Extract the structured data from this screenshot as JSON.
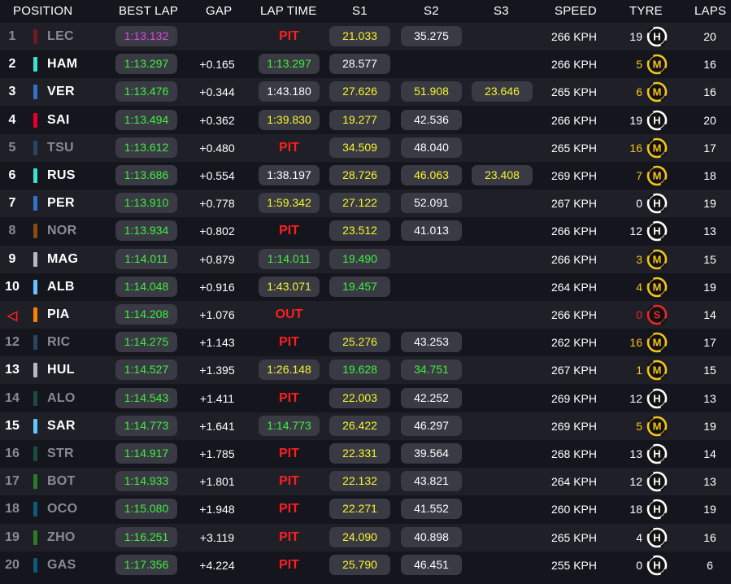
{
  "headers": {
    "position": "POSITION",
    "best_lap": "BEST LAP",
    "gap": "GAP",
    "lap_time": "LAP TIME",
    "s1": "S1",
    "s2": "S2",
    "s3": "S3",
    "speed": "SPEED",
    "tyre": "TYRE",
    "laps": "LAPS"
  },
  "colors": {
    "purple": "#e347e3",
    "green": "#3ef03e",
    "yellow": "#f5f52c",
    "pit_red": "#ff1e1e",
    "medium": "#f5c518",
    "hard": "#ffffff",
    "soft": "#e8292c"
  },
  "rows": [
    {
      "pos": "1",
      "dim": true,
      "code": "LEC",
      "team_color": "#6e1a22",
      "best": "1:13.132",
      "best_purple": true,
      "gap": "",
      "lap": "PIT",
      "lap_style": "pit",
      "s1": "21.033",
      "s1c": "y",
      "s2": "35.275",
      "s2c": "w",
      "s3": "",
      "s3c": "",
      "speed": "266 KPH",
      "age": "19",
      "age_c": "w",
      "tyre": "H",
      "tyre_icon": "hard-tyre-icon",
      "laps": "20"
    },
    {
      "pos": "2",
      "dim": false,
      "code": "HAM",
      "team_color": "#3fe0c8",
      "best": "1:13.297",
      "best_purple": false,
      "gap": "+0.165",
      "lap": "1:13.297",
      "lap_style": "g",
      "s1": "28.577",
      "s1c": "w",
      "s2": "",
      "s2c": "",
      "s3": "",
      "s3c": "",
      "speed": "266 KPH",
      "age": "5",
      "age_c": "y",
      "tyre": "M",
      "tyre_icon": "medium-tyre-icon",
      "laps": "16"
    },
    {
      "pos": "3",
      "dim": false,
      "code": "VER",
      "team_color": "#3671c6",
      "best": "1:13.476",
      "best_purple": false,
      "gap": "+0.344",
      "lap": "1:43.180",
      "lap_style": "w",
      "s1": "27.626",
      "s1c": "y",
      "s2": "51.908",
      "s2c": "y",
      "s3": "23.646",
      "s3c": "y",
      "speed": "265 KPH",
      "age": "6",
      "age_c": "y",
      "tyre": "M",
      "tyre_icon": "medium-tyre-icon",
      "laps": "16"
    },
    {
      "pos": "4",
      "dim": false,
      "code": "SAI",
      "team_color": "#e8002d",
      "best": "1:13.494",
      "best_purple": false,
      "gap": "+0.362",
      "lap": "1:39.830",
      "lap_style": "y",
      "s1": "19.277",
      "s1c": "y",
      "s2": "42.536",
      "s2c": "w",
      "s3": "",
      "s3c": "",
      "speed": "266 KPH",
      "age": "19",
      "age_c": "w",
      "tyre": "H",
      "tyre_icon": "hard-tyre-icon",
      "laps": "20"
    },
    {
      "pos": "5",
      "dim": true,
      "code": "TSU",
      "team_color": "#2b4562",
      "best": "1:13.612",
      "best_purple": false,
      "gap": "+0.480",
      "lap": "PIT",
      "lap_style": "pit",
      "s1": "34.509",
      "s1c": "y",
      "s2": "48.040",
      "s2c": "w",
      "s3": "",
      "s3c": "",
      "speed": "265 KPH",
      "age": "16",
      "age_c": "y",
      "tyre": "M",
      "tyre_icon": "medium-tyre-icon",
      "laps": "17"
    },
    {
      "pos": "6",
      "dim": false,
      "code": "RUS",
      "team_color": "#3fe0c8",
      "best": "1:13.686",
      "best_purple": false,
      "gap": "+0.554",
      "lap": "1:38.197",
      "lap_style": "w",
      "s1": "28.726",
      "s1c": "y",
      "s2": "46.063",
      "s2c": "y",
      "s3": "23.408",
      "s3c": "y",
      "speed": "269 KPH",
      "age": "7",
      "age_c": "y",
      "tyre": "M",
      "tyre_icon": "medium-tyre-icon",
      "laps": "18"
    },
    {
      "pos": "7",
      "dim": false,
      "code": "PER",
      "team_color": "#3671c6",
      "best": "1:13.910",
      "best_purple": false,
      "gap": "+0.778",
      "lap": "1:59.342",
      "lap_style": "y",
      "s1": "27.122",
      "s1c": "y",
      "s2": "52.091",
      "s2c": "w",
      "s3": "",
      "s3c": "",
      "speed": "267 KPH",
      "age": "0",
      "age_c": "w",
      "tyre": "H",
      "tyre_icon": "hard-tyre-icon",
      "laps": "19"
    },
    {
      "pos": "8",
      "dim": true,
      "code": "NOR",
      "team_color": "#8a4a10",
      "best": "1:13.934",
      "best_purple": false,
      "gap": "+0.802",
      "lap": "PIT",
      "lap_style": "pit",
      "s1": "23.512",
      "s1c": "y",
      "s2": "41.013",
      "s2c": "w",
      "s3": "",
      "s3c": "",
      "speed": "266 KPH",
      "age": "12",
      "age_c": "w",
      "tyre": "H",
      "tyre_icon": "hard-tyre-icon",
      "laps": "13"
    },
    {
      "pos": "9",
      "dim": false,
      "code": "MAG",
      "team_color": "#b6babd",
      "best": "1:14.011",
      "best_purple": false,
      "gap": "+0.879",
      "lap": "1:14.011",
      "lap_style": "g",
      "s1": "19.490",
      "s1c": "g",
      "s2": "",
      "s2c": "",
      "s3": "",
      "s3c": "",
      "speed": "266 KPH",
      "age": "3",
      "age_c": "y",
      "tyre": "M",
      "tyre_icon": "medium-tyre-icon",
      "laps": "15"
    },
    {
      "pos": "10",
      "dim": false,
      "code": "ALB",
      "team_color": "#64c4ff",
      "best": "1:14.048",
      "best_purple": false,
      "gap": "+0.916",
      "lap": "1:43.071",
      "lap_style": "y",
      "s1": "19.457",
      "s1c": "g",
      "s2": "",
      "s2c": "",
      "s3": "",
      "s3c": "",
      "speed": "264 KPH",
      "age": "4",
      "age_c": "y",
      "tyre": "M",
      "tyre_icon": "medium-tyre-icon",
      "laps": "19"
    },
    {
      "pos": "◁",
      "dim": false,
      "posred": true,
      "code": "PIA",
      "team_color": "#ff8000",
      "best": "1:14.208",
      "best_purple": false,
      "gap": "+1.076",
      "lap": "OUT",
      "lap_style": "pit",
      "s1": "",
      "s1c": "",
      "s2": "",
      "s2c": "",
      "s3": "",
      "s3c": "",
      "speed": "266 KPH",
      "age": "0",
      "age_c": "r",
      "tyre": "S",
      "tyre_icon": "soft-tyre-icon",
      "laps": "14"
    },
    {
      "pos": "12",
      "dim": true,
      "code": "RIC",
      "team_color": "#2b4562",
      "best": "1:14.275",
      "best_purple": false,
      "gap": "+1.143",
      "lap": "PIT",
      "lap_style": "pit",
      "s1": "25.276",
      "s1c": "y",
      "s2": "43.253",
      "s2c": "w",
      "s3": "",
      "s3c": "",
      "speed": "262 KPH",
      "age": "16",
      "age_c": "y",
      "tyre": "M",
      "tyre_icon": "medium-tyre-icon",
      "laps": "17"
    },
    {
      "pos": "13",
      "dim": false,
      "code": "HUL",
      "team_color": "#b6babd",
      "best": "1:14.527",
      "best_purple": false,
      "gap": "+1.395",
      "lap": "1:26.148",
      "lap_style": "y",
      "s1": "19.628",
      "s1c": "g",
      "s2": "34.751",
      "s2c": "g",
      "s3": "",
      "s3c": "",
      "speed": "267 KPH",
      "age": "1",
      "age_c": "y",
      "tyre": "M",
      "tyre_icon": "medium-tyre-icon",
      "laps": "15"
    },
    {
      "pos": "14",
      "dim": true,
      "code": "ALO",
      "team_color": "#1b4d3e",
      "best": "1:14.543",
      "best_purple": false,
      "gap": "+1.411",
      "lap": "PIT",
      "lap_style": "pit",
      "s1": "22.003",
      "s1c": "y",
      "s2": "42.252",
      "s2c": "w",
      "s3": "",
      "s3c": "",
      "speed": "269 KPH",
      "age": "12",
      "age_c": "w",
      "tyre": "H",
      "tyre_icon": "hard-tyre-icon",
      "laps": "13"
    },
    {
      "pos": "15",
      "dim": false,
      "code": "SAR",
      "team_color": "#64c4ff",
      "best": "1:14.773",
      "best_purple": false,
      "gap": "+1.641",
      "lap": "1:14.773",
      "lap_style": "g",
      "s1": "26.422",
      "s1c": "y",
      "s2": "46.297",
      "s2c": "w",
      "s3": "",
      "s3c": "",
      "speed": "269 KPH",
      "age": "5",
      "age_c": "y",
      "tyre": "M",
      "tyre_icon": "medium-tyre-icon",
      "laps": "19"
    },
    {
      "pos": "16",
      "dim": true,
      "code": "STR",
      "team_color": "#1b4d3e",
      "best": "1:14.917",
      "best_purple": false,
      "gap": "+1.785",
      "lap": "PIT",
      "lap_style": "pit",
      "s1": "22.331",
      "s1c": "y",
      "s2": "39.564",
      "s2c": "w",
      "s3": "",
      "s3c": "",
      "speed": "268 KPH",
      "age": "13",
      "age_c": "w",
      "tyre": "H",
      "tyre_icon": "hard-tyre-icon",
      "laps": "14"
    },
    {
      "pos": "17",
      "dim": true,
      "code": "BOT",
      "team_color": "#2a7a2a",
      "best": "1:14.933",
      "best_purple": false,
      "gap": "+1.801",
      "lap": "PIT",
      "lap_style": "pit",
      "s1": "22.132",
      "s1c": "y",
      "s2": "43.821",
      "s2c": "w",
      "s3": "",
      "s3c": "",
      "speed": "264 KPH",
      "age": "12",
      "age_c": "w",
      "tyre": "H",
      "tyre_icon": "hard-tyre-icon",
      "laps": "13"
    },
    {
      "pos": "18",
      "dim": true,
      "code": "OCO",
      "team_color": "#0f5a7a",
      "best": "1:15.080",
      "best_purple": false,
      "gap": "+1.948",
      "lap": "PIT",
      "lap_style": "pit",
      "s1": "22.271",
      "s1c": "y",
      "s2": "41.552",
      "s2c": "w",
      "s3": "",
      "s3c": "",
      "speed": "260 KPH",
      "age": "18",
      "age_c": "w",
      "tyre": "H",
      "tyre_icon": "hard-tyre-icon",
      "laps": "19"
    },
    {
      "pos": "19",
      "dim": true,
      "code": "ZHO",
      "team_color": "#2a7a2a",
      "best": "1:16.251",
      "best_purple": false,
      "gap": "+3.119",
      "lap": "PIT",
      "lap_style": "pit",
      "s1": "24.090",
      "s1c": "y",
      "s2": "40.898",
      "s2c": "w",
      "s3": "",
      "s3c": "",
      "speed": "265 KPH",
      "age": "4",
      "age_c": "w",
      "tyre": "H",
      "tyre_icon": "hard-tyre-icon",
      "laps": "16"
    },
    {
      "pos": "20",
      "dim": true,
      "code": "GAS",
      "team_color": "#0f5a7a",
      "best": "1:17.356",
      "best_purple": false,
      "gap": "+4.224",
      "lap": "PIT",
      "lap_style": "pit",
      "s1": "25.790",
      "s1c": "y",
      "s2": "46.451",
      "s2c": "w",
      "s3": "",
      "s3c": "",
      "speed": "255 KPH",
      "age": "0",
      "age_c": "w",
      "tyre": "H",
      "tyre_icon": "hard-tyre-icon",
      "laps": "6"
    }
  ]
}
